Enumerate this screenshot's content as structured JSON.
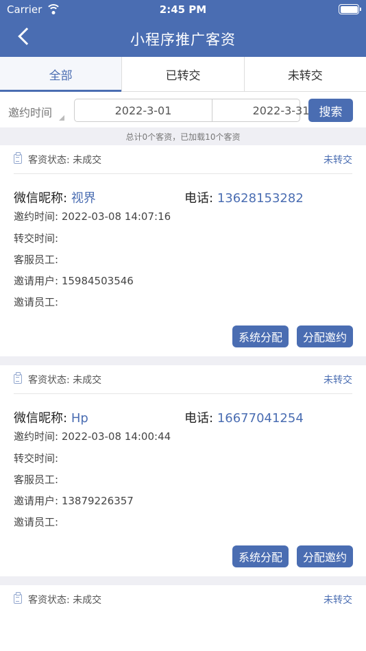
{
  "status_bar": {
    "carrier": "Carrier",
    "time": "2:45 PM"
  },
  "header": {
    "title": "小程序推广客资"
  },
  "tabs": [
    {
      "label": "全部",
      "active": true
    },
    {
      "label": "已转交",
      "active": false
    },
    {
      "label": "未转交",
      "active": false
    }
  ],
  "filter": {
    "label": "邀约时间",
    "start_date": "2022-3-01",
    "end_date": "2022-3-31",
    "search_label": "搜索"
  },
  "summary": "总计0个客资，已加载10个客资",
  "labels": {
    "status": "客资状态:",
    "nickname": "微信昵称:",
    "phone": "电话:",
    "invite_time": "邀约时间:",
    "transfer_time": "转交时间:",
    "service_staff": "客服员工:",
    "invite_user": "邀请用户:",
    "invite_staff": "邀请员工:",
    "btn_system_assign": "系统分配",
    "btn_assign_invite": "分配邀约"
  },
  "cards": [
    {
      "status": "未成交",
      "tag": "未转交",
      "nickname": "视界",
      "phone": "13628153282",
      "invite_time": "2022-03-08 14:07:16",
      "transfer_time": "",
      "service_staff": "",
      "invite_user": "15984503546",
      "invite_staff": ""
    },
    {
      "status": "未成交",
      "tag": "未转交",
      "nickname": "Hp",
      "phone": "16677041254",
      "invite_time": "2022-03-08 14:00:44",
      "transfer_time": "",
      "service_staff": "",
      "invite_user": "13879226357",
      "invite_staff": ""
    },
    {
      "status": "未成交",
      "tag": "未转交"
    }
  ],
  "colors": {
    "primary": "#4a6db2",
    "background": "#efeff4"
  },
  "icons": {
    "back": "chevron-left-icon",
    "clipboard": "clipboard-icon",
    "wifi": "wifi-icon",
    "battery": "battery-icon"
  }
}
